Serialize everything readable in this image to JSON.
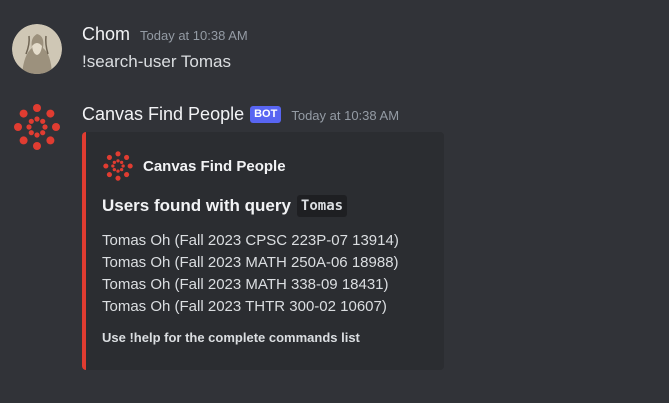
{
  "messages": [
    {
      "username": "Chom",
      "timestamp": "Today at 10:38 AM",
      "content": "!search-user Tomas"
    },
    {
      "username": "Canvas Find People",
      "bot_tag": "BOT",
      "timestamp": "Today at 10:38 AM",
      "embed": {
        "author": "Canvas Find People",
        "title_prefix": "Users found with query",
        "title_query": "Tomas",
        "results": [
          "Tomas Oh (Fall 2023 CPSC 223P-07 13914)",
          "Tomas Oh (Fall 2023 MATH 250A-06 18988)",
          "Tomas Oh (Fall 2023 MATH 338-09 18431)",
          "Tomas Oh (Fall 2023 THTR 300-02 10607)"
        ],
        "footer": "Use !help for the complete commands list",
        "accent_color": "#e03c31"
      }
    }
  ],
  "icons": {
    "user_avatar": "sketch-portrait-avatar",
    "bot_avatar": "canvas-logo-icon",
    "embed_author_icon": "canvas-logo-icon"
  }
}
